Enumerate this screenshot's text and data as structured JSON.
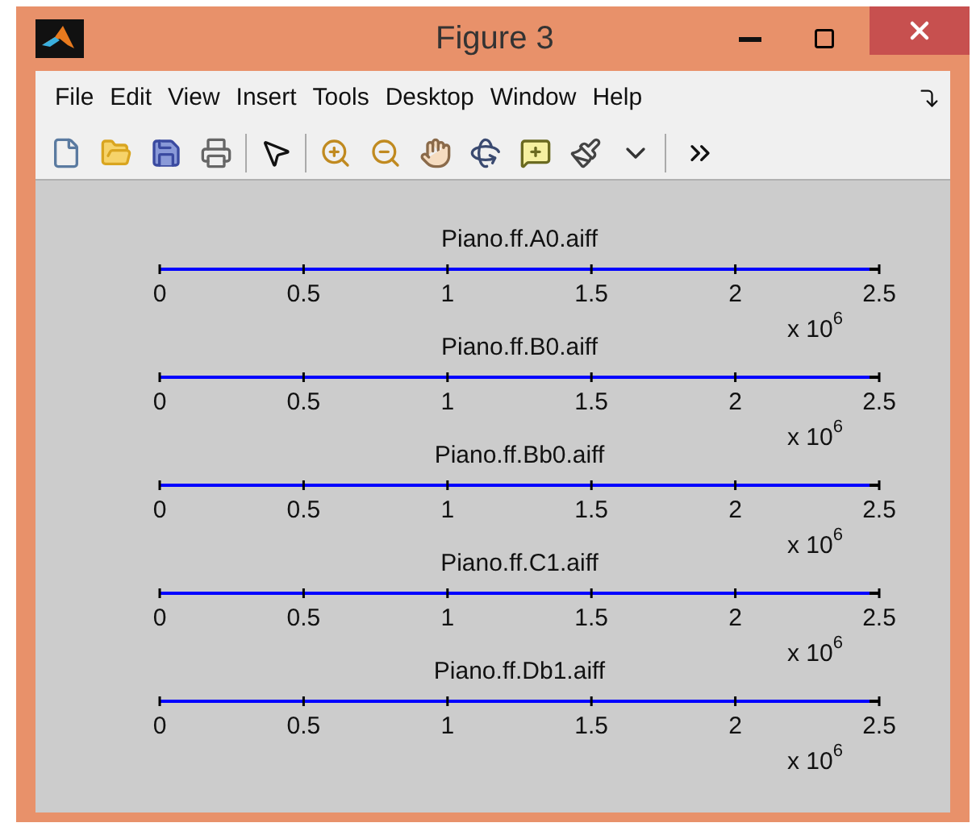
{
  "window": {
    "title": "Figure 3"
  },
  "menu": [
    "File",
    "Edit",
    "View",
    "Insert",
    "Tools",
    "Desktop",
    "Window",
    "Help"
  ],
  "plots": [
    {
      "title": "Piano.ff.A0.aiff",
      "ticks": [
        "0",
        "0.5",
        "1",
        "1.5",
        "2",
        "2.5"
      ],
      "multiplier": "x 10",
      "exponent": "6"
    },
    {
      "title": "Piano.ff.B0.aiff",
      "ticks": [
        "0",
        "0.5",
        "1",
        "1.5",
        "2",
        "2.5"
      ],
      "multiplier": "x 10",
      "exponent": "6"
    },
    {
      "title": "Piano.ff.Bb0.aiff",
      "ticks": [
        "0",
        "0.5",
        "1",
        "1.5",
        "2",
        "2.5"
      ],
      "multiplier": "x 10",
      "exponent": "6"
    },
    {
      "title": "Piano.ff.C1.aiff",
      "ticks": [
        "0",
        "0.5",
        "1",
        "1.5",
        "2",
        "2.5"
      ],
      "multiplier": "x 10",
      "exponent": "6"
    },
    {
      "title": "Piano.ff.Db1.aiff",
      "ticks": [
        "0",
        "0.5",
        "1",
        "1.5",
        "2",
        "2.5"
      ],
      "multiplier": "x 10",
      "exponent": "6"
    }
  ]
}
